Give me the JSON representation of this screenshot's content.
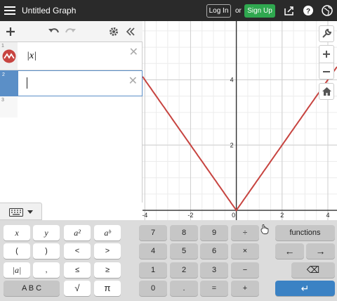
{
  "app": {
    "title": "Untitled Graph"
  },
  "topbar": {
    "login": "Log In",
    "or": "or",
    "signup": "Sign Up",
    "signup_color": "#2fa84f"
  },
  "expressions": [
    {
      "num": "1",
      "latex": "|x|",
      "color": "#c74440"
    },
    {
      "num": "2",
      "latex": "",
      "active": true
    },
    {
      "num": "3",
      "latex": ""
    }
  ],
  "graph": {
    "xticks": [
      "-4",
      "-2",
      "0",
      "2",
      "4"
    ],
    "yticks": [
      "2",
      "4"
    ],
    "function": "|x|",
    "curve_color": "#c74440",
    "xlim": [
      -4.1,
      4.4
    ],
    "ylim": [
      -0.3,
      5.8
    ]
  },
  "keypad": {
    "row1": [
      "x",
      "y",
      "a²",
      "aᵇ",
      "7",
      "8",
      "9",
      "÷",
      "functions"
    ],
    "row2": [
      "(",
      ")",
      "<",
      ">",
      "4",
      "5",
      "6",
      "×",
      "←",
      "→"
    ],
    "row3": [
      "|a|",
      ",",
      "≤",
      "≥",
      "1",
      "2",
      "3",
      "−",
      "⌫"
    ],
    "row4": [
      "A B C",
      "√",
      "π",
      "0",
      ".",
      "=",
      "+",
      "↵"
    ]
  }
}
